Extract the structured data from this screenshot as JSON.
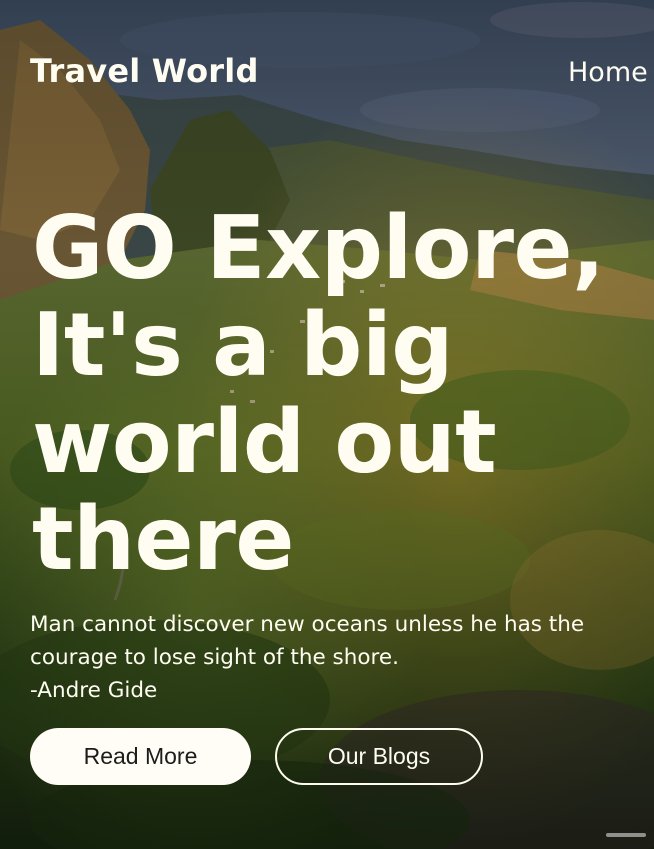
{
  "navbar": {
    "brand": "Travel World",
    "links": [
      "Home"
    ]
  },
  "hero": {
    "headline_lines": [
      "GO Explore,",
      "It's a big",
      "world out",
      "there"
    ],
    "quote": "Man cannot discover new oceans unless he has the courage to lose sight of the shore.",
    "quote_author": "-Andre Gide",
    "buttons": {
      "read_more": "Read More",
      "our_blogs": "Our Blogs"
    },
    "background": "mountain-jungle-landscape-photo"
  },
  "colors": {
    "text": "#fffdf2",
    "button_fill": "#fffdf5",
    "button_text": "#1c1c1c"
  }
}
